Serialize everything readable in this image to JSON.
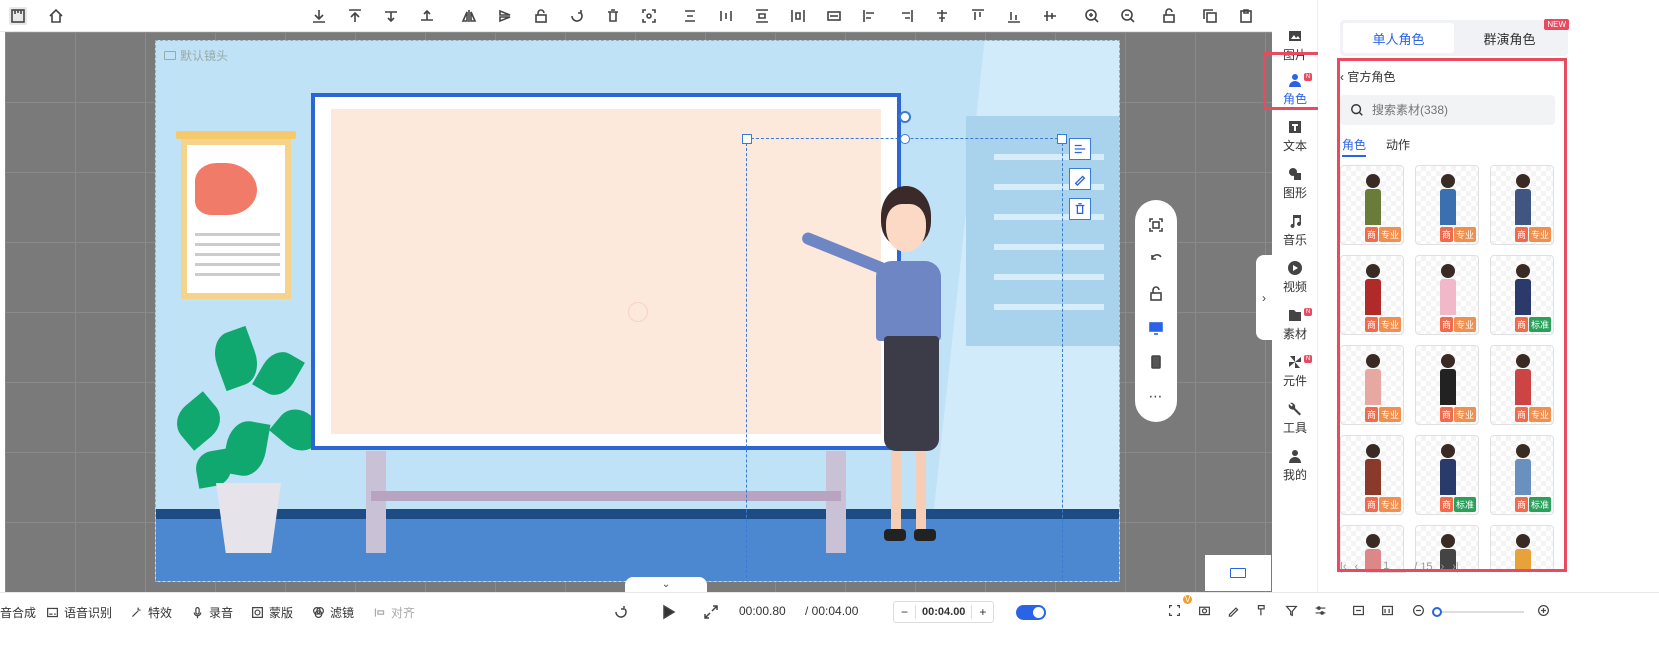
{
  "stage": {
    "camera_label": "默认镜头"
  },
  "sidebar": {
    "items": [
      {
        "label": "图片",
        "icon": "image-icon"
      },
      {
        "label": "角色",
        "icon": "person-icon",
        "badge": "N",
        "active": true
      },
      {
        "label": "文本",
        "icon": "text-icon"
      },
      {
        "label": "图形",
        "icon": "shape-icon"
      },
      {
        "label": "音乐",
        "icon": "music-icon"
      },
      {
        "label": "视频",
        "icon": "video-icon"
      },
      {
        "label": "素材",
        "icon": "folder-icon",
        "badge": "N"
      },
      {
        "label": "元件",
        "icon": "component-icon",
        "badge": "N"
      },
      {
        "label": "工具",
        "icon": "wrench-icon"
      },
      {
        "label": "我的",
        "icon": "user-icon"
      }
    ],
    "badge_text": "N"
  },
  "panel": {
    "tab_single": "单人角色",
    "tab_group": "群演角色",
    "new_badge": "NEW",
    "back_label": "官方角色",
    "search_placeholder": "搜索素材(338)",
    "subtab_roles": "角色",
    "subtab_actions": "动作",
    "pager_current": "1",
    "pager_total": "/ 15",
    "tag_commercial": "商",
    "tag_pro": "专业",
    "tag_std": "标准"
  },
  "bottombar": {
    "compose": "音合成",
    "speech": "语音识别",
    "effects": "特效",
    "record": "录音",
    "mask": "蒙版",
    "filter": "滤镜",
    "align": "对齐",
    "time_current": "00:00.80",
    "time_total": "/ 00:04.00",
    "duration": "00:04.00",
    "v_badge": "V"
  },
  "colors": {
    "accent": "#2b63e6",
    "highlight": "#e84a5f"
  }
}
